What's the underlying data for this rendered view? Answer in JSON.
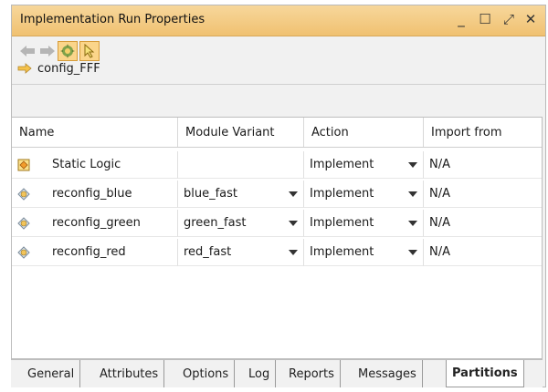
{
  "window": {
    "title": "Implementation Run Properties",
    "controls": {
      "minimize": "_",
      "maximize": "☐",
      "float": "⤢",
      "close": "✕"
    }
  },
  "toolbar": {
    "buttons": [
      {
        "icon": "back-arrow-icon",
        "enabled": false
      },
      {
        "icon": "forward-arrow-icon",
        "enabled": false
      },
      {
        "icon": "settings-gear-icon",
        "active": true
      },
      {
        "icon": "select-cursor-icon",
        "active": true
      }
    ]
  },
  "config": {
    "name": "config_FFF",
    "icon": "arrow-right-icon"
  },
  "table": {
    "headers": [
      "Name",
      "Module Variant",
      "Action",
      "Import from"
    ],
    "rows": [
      {
        "name": "Static Logic",
        "variant": "",
        "action": "Implement",
        "import_from": "N/A",
        "icon": "static-logic-icon"
      },
      {
        "name": "reconfig_blue",
        "variant": "blue_fast",
        "action": "Implement",
        "import_from": "N/A",
        "icon": "reconfig-module-icon"
      },
      {
        "name": "reconfig_green",
        "variant": "green_fast",
        "action": "Implement",
        "import_from": "N/A",
        "icon": "reconfig-module-icon"
      },
      {
        "name": "reconfig_red",
        "variant": "red_fast",
        "action": "Implement",
        "import_from": "N/A",
        "icon": "reconfig-module-icon"
      }
    ]
  },
  "tabs": [
    "General",
    "Attributes",
    "Options",
    "Log",
    "Reports",
    "Messages",
    "Partitions"
  ],
  "active_tab": "Partitions",
  "colors": {
    "titlebar": "#f0c171",
    "accent": "#fbd58a",
    "border": "#bdbdbd"
  }
}
